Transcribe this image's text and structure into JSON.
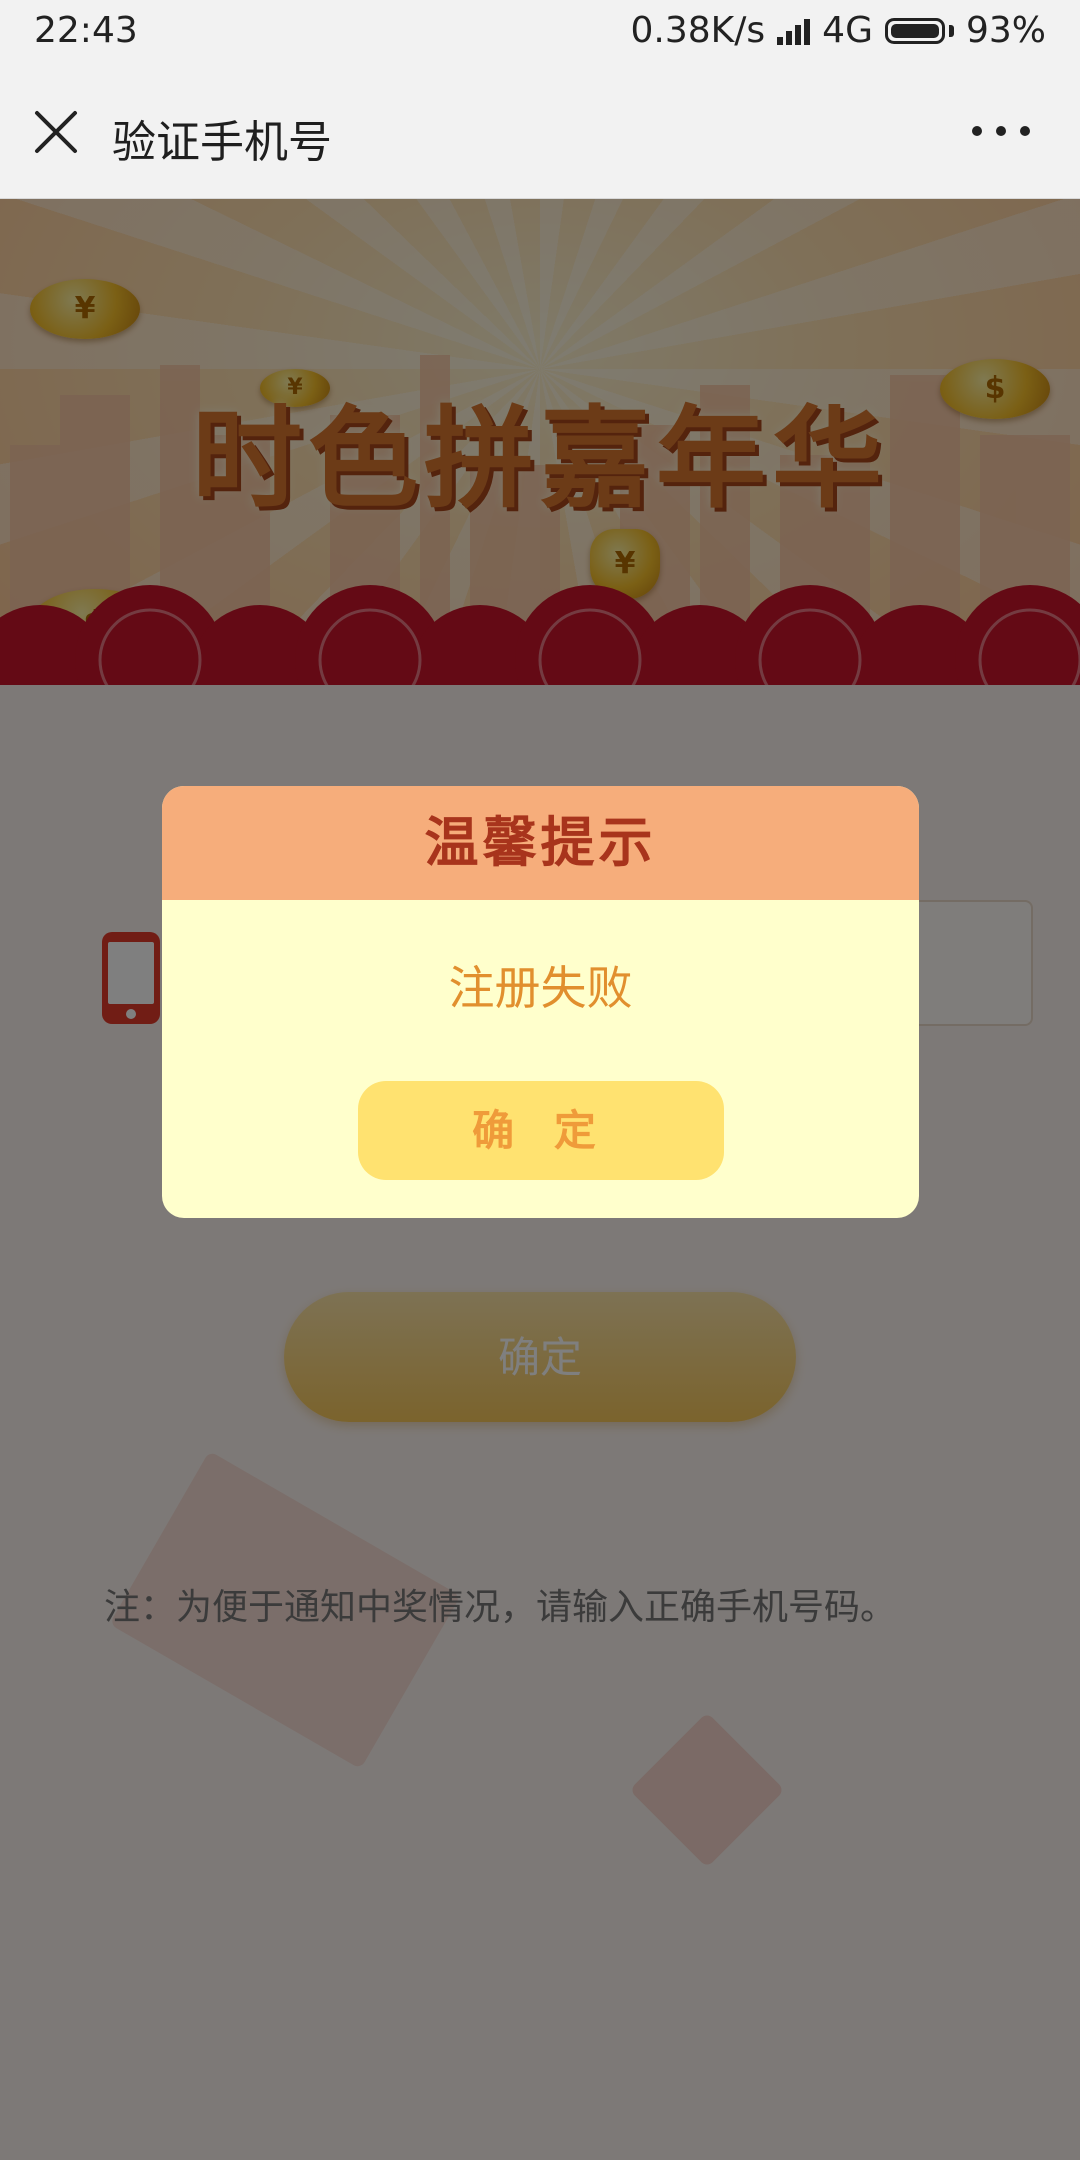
{
  "status_bar": {
    "time": "22:43",
    "net_speed": "0.38K/s",
    "network": "4G",
    "battery": "93%"
  },
  "title_bar": {
    "title": "验证手机号",
    "close_icon": "close-icon",
    "more_icon": "more-icon"
  },
  "banner": {
    "headline": "时色拼嘉年华"
  },
  "form": {
    "phone_icon": "phone-icon",
    "phone_input_value": "",
    "confirm_label": "确定",
    "note": "注：为便于通知中奖情况，请输入正确手机号码。"
  },
  "dialog": {
    "title": "温馨提示",
    "message": "注册失败",
    "ok_label": "确 定"
  },
  "colors": {
    "dialog_header": "#f6ad7b",
    "dialog_body": "#ffffcc",
    "dialog_title": "#a8341c",
    "dialog_message": "#e18f2e",
    "dialog_button": "#ffe270",
    "dialog_button_text": "#ef9b3a"
  }
}
